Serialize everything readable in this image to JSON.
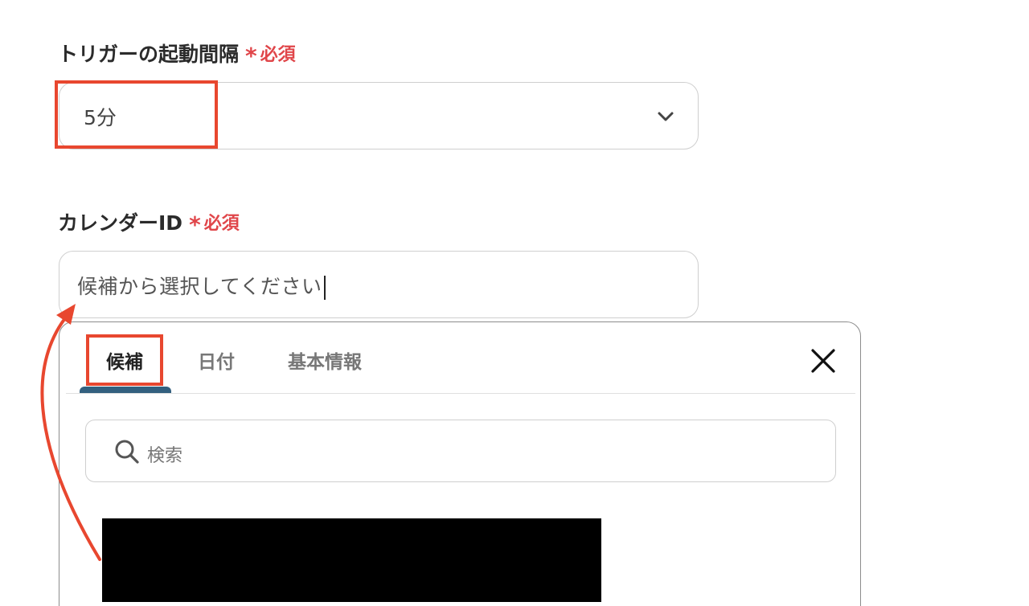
{
  "trigger_interval": {
    "label": "トリガーの起動間隔",
    "asterisk": "*",
    "required": "必須",
    "value": "5分"
  },
  "calendar_id": {
    "label": "カレンダーID",
    "asterisk": "*",
    "required": "必須",
    "placeholder": "候補から選択してください"
  },
  "popover": {
    "tabs": [
      {
        "label": "候補",
        "active": true
      },
      {
        "label": "日付",
        "active": false
      },
      {
        "label": "基本情報",
        "active": false
      }
    ],
    "search_placeholder": "検索",
    "close_icon": "close-icon",
    "search_icon": "search-icon"
  },
  "colors": {
    "required": "#e0464a",
    "annotation": "#e8472f",
    "tab_underline": "#33607f"
  }
}
